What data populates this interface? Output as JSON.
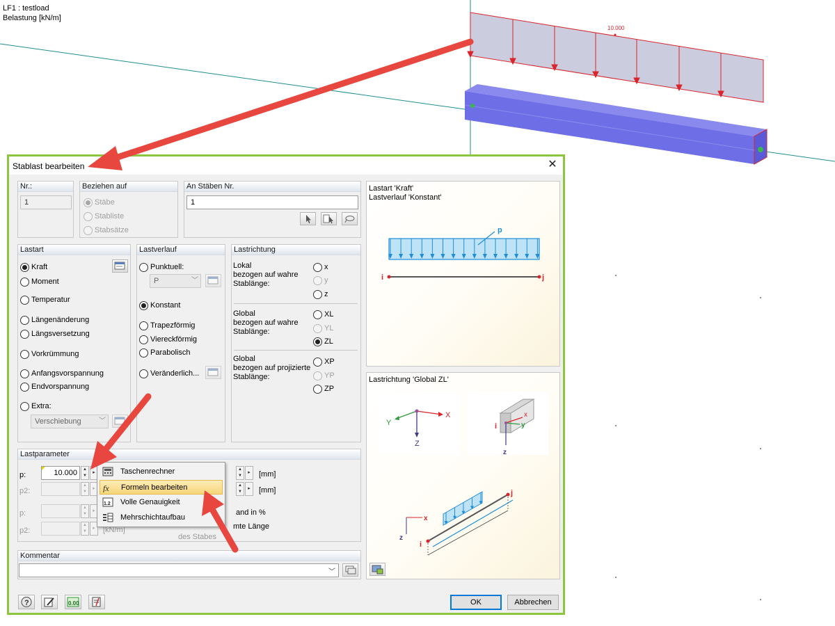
{
  "viewport": {
    "load_case": "LF1 : testload",
    "load_unit": "Belastung [kN/m]",
    "load_value": "10.000"
  },
  "dialog": {
    "title": "Stablast bearbeiten",
    "nr": {
      "header": "Nr.:",
      "value": "1"
    },
    "beziehen": {
      "header": "Beziehen auf",
      "options": [
        "Stäbe",
        "Stabliste",
        "Stabsätze"
      ]
    },
    "an_staeben": {
      "header": "An Stäben Nr.",
      "value": "1"
    },
    "lastart": {
      "header": "Lastart",
      "options": [
        "Kraft",
        "Moment",
        "Temperatur",
        "Längenänderung",
        "Längsversetzung",
        "Vorkrümmung",
        "Anfangsvorspannung",
        "Endvorspannung",
        "Extra:"
      ],
      "selected": "Kraft",
      "extra_combo": "Verschiebung"
    },
    "lastverlauf": {
      "header": "Lastverlauf",
      "options": [
        "Punktuell:",
        "Konstant",
        "Trapezförmig",
        "Viereckförmig",
        "Parabolisch",
        "Veränderlich..."
      ],
      "selected": "Konstant",
      "punktuell_combo": "P"
    },
    "lastrichtung": {
      "header": "Lastrichtung",
      "lokal_label": "Lokal\nbezogen auf wahre\nStablänge:",
      "lokal_options": [
        "x",
        "y",
        "z"
      ],
      "global_label": "Global\nbezogen auf wahre\nStablänge:",
      "global_options": [
        "XL",
        "YL",
        "ZL"
      ],
      "projected_label": "Global\nbezogen auf projizierte\nStablänge:",
      "projected_options": [
        "XP",
        "YP",
        "ZP"
      ],
      "selected": "ZL"
    },
    "lastparameter": {
      "header": "Lastparameter",
      "p_label": "p:",
      "p_value": "10.000",
      "p2_label": "p2:",
      "p3_label": "p:",
      "p4_label": "p2:",
      "unit_mm_1": "[mm]",
      "unit_mm_2": "[mm]",
      "unit_kn": "[kN/m]",
      "text_percent": "and in %",
      "text_length": "mte Länge",
      "text_stab": "des Stabes"
    },
    "kommentar": {
      "header": "Kommentar",
      "value": ""
    },
    "preview_top": {
      "line1": "Lastart 'Kraft'",
      "line2": "Lastverlauf 'Konstant'",
      "label_p": "p",
      "label_i": "i",
      "label_j": "j"
    },
    "preview_bottom": {
      "title": "Lastrichtung 'Global ZL'",
      "axis_x": "X",
      "axis_y": "Y",
      "axis_z": "Z",
      "local_x": "x",
      "local_y": "y",
      "local_z": "z",
      "iso_x": "x",
      "iso_z": "z",
      "iso_i": "i",
      "iso_j": "j"
    },
    "buttons": {
      "ok": "OK",
      "cancel": "Abbrechen"
    }
  },
  "context_menu": {
    "items": [
      "Taschenrechner",
      "Formeln bearbeiten",
      "Volle Genauigkeit",
      "Mehrschichtaufbau"
    ],
    "highlighted": "Formeln bearbeiten"
  },
  "colors": {
    "accent_green": "#8cc63f",
    "arrow_red": "#e8473f",
    "load_red": "#d9252b",
    "beam_blue": "#6f6fe8",
    "preview_blue": "#1e8ed8"
  }
}
